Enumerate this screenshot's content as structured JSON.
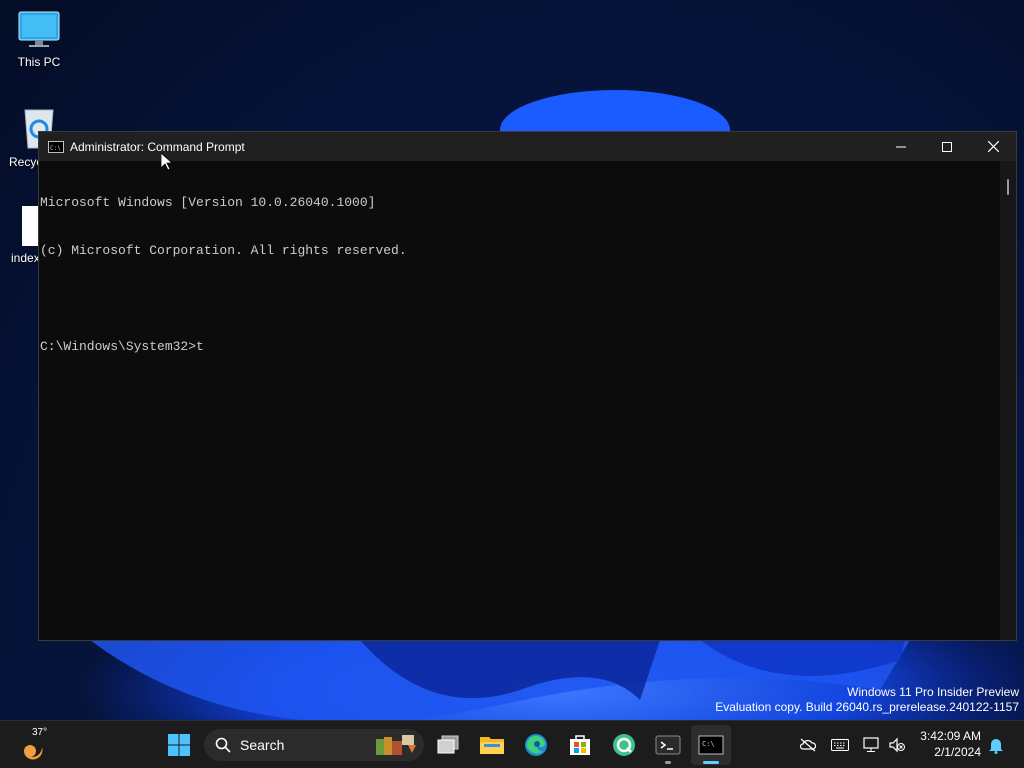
{
  "desktop": {
    "icons": [
      {
        "label": "This PC"
      },
      {
        "label": "Recyc"
      },
      {
        "label": "index"
      }
    ],
    "watermark": {
      "line1": "Windows 11 Pro Insider Preview",
      "line2": "Evaluation copy. Build 26040.rs_prerelease.240122-1157"
    }
  },
  "window": {
    "title": "Administrator: Command Prompt",
    "controls": {
      "minimize": "—",
      "maximize": "☐",
      "close": "✕"
    },
    "console_lines": [
      "Microsoft Windows [Version 10.0.26040.1000]",
      "(c) Microsoft Corporation. All rights reserved.",
      "",
      "C:\\Windows\\System32>t"
    ]
  },
  "taskbar": {
    "weather": {
      "temp": "37°"
    },
    "search": {
      "label": "Search"
    },
    "apps": [
      {
        "name": "start"
      },
      {
        "name": "task-view"
      },
      {
        "name": "file-explorer"
      },
      {
        "name": "edge"
      },
      {
        "name": "store"
      },
      {
        "name": "app-q"
      },
      {
        "name": "terminal"
      },
      {
        "name": "command-prompt"
      }
    ],
    "clock": {
      "time": "3:42:09 AM",
      "date": "2/1/2024"
    }
  },
  "colors": {
    "accent": "#60cdff",
    "taskbar": "#1c1c1c",
    "console_bg": "#0c0c0c",
    "console_text": "#cccccc"
  }
}
